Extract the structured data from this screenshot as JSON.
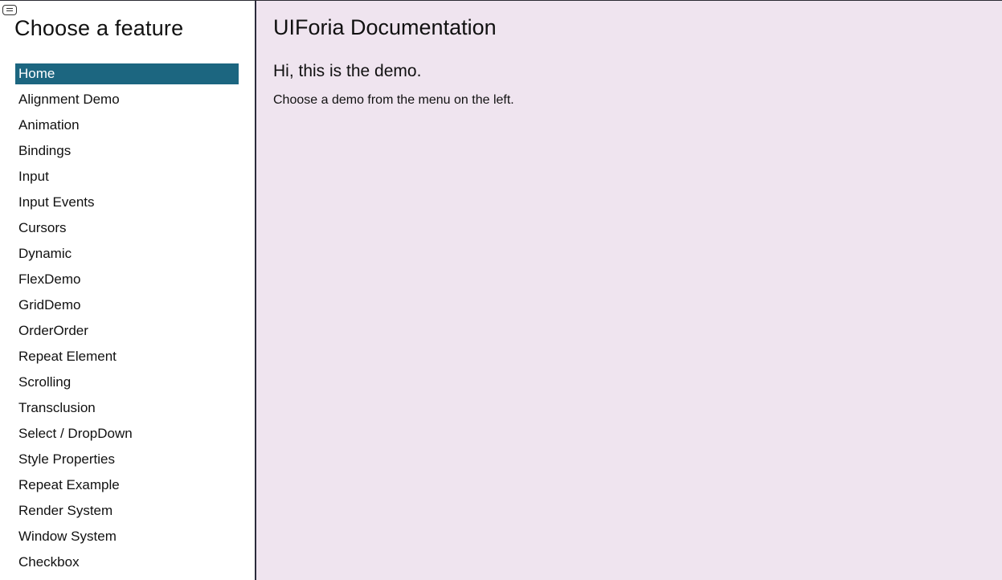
{
  "sidebar": {
    "toggle_icon": "hamburger-menu-icon",
    "title": "Choose a feature",
    "items": [
      {
        "label": "Home",
        "active": true
      },
      {
        "label": "Alignment Demo"
      },
      {
        "label": "Animation"
      },
      {
        "label": "Bindings"
      },
      {
        "label": "Input"
      },
      {
        "label": "Input Events"
      },
      {
        "label": "Cursors"
      },
      {
        "label": "Dynamic"
      },
      {
        "label": "FlexDemo"
      },
      {
        "label": "GridDemo"
      },
      {
        "label": "OrderOrder"
      },
      {
        "label": "Repeat Element"
      },
      {
        "label": "Scrolling"
      },
      {
        "label": "Transclusion"
      },
      {
        "label": "Select / DropDown"
      },
      {
        "label": "Style Properties"
      },
      {
        "label": "Repeat Example"
      },
      {
        "label": "Render System"
      },
      {
        "label": "Window System"
      },
      {
        "label": "Checkbox"
      }
    ]
  },
  "main": {
    "title": "UIForia Documentation",
    "heading": "Hi, this is the demo.",
    "text": "Choose a demo from the menu on the left."
  },
  "colors": {
    "active_item_bg": "#1c6680",
    "main_bg": "#efe4ef",
    "divider": "#2b2b3b"
  }
}
